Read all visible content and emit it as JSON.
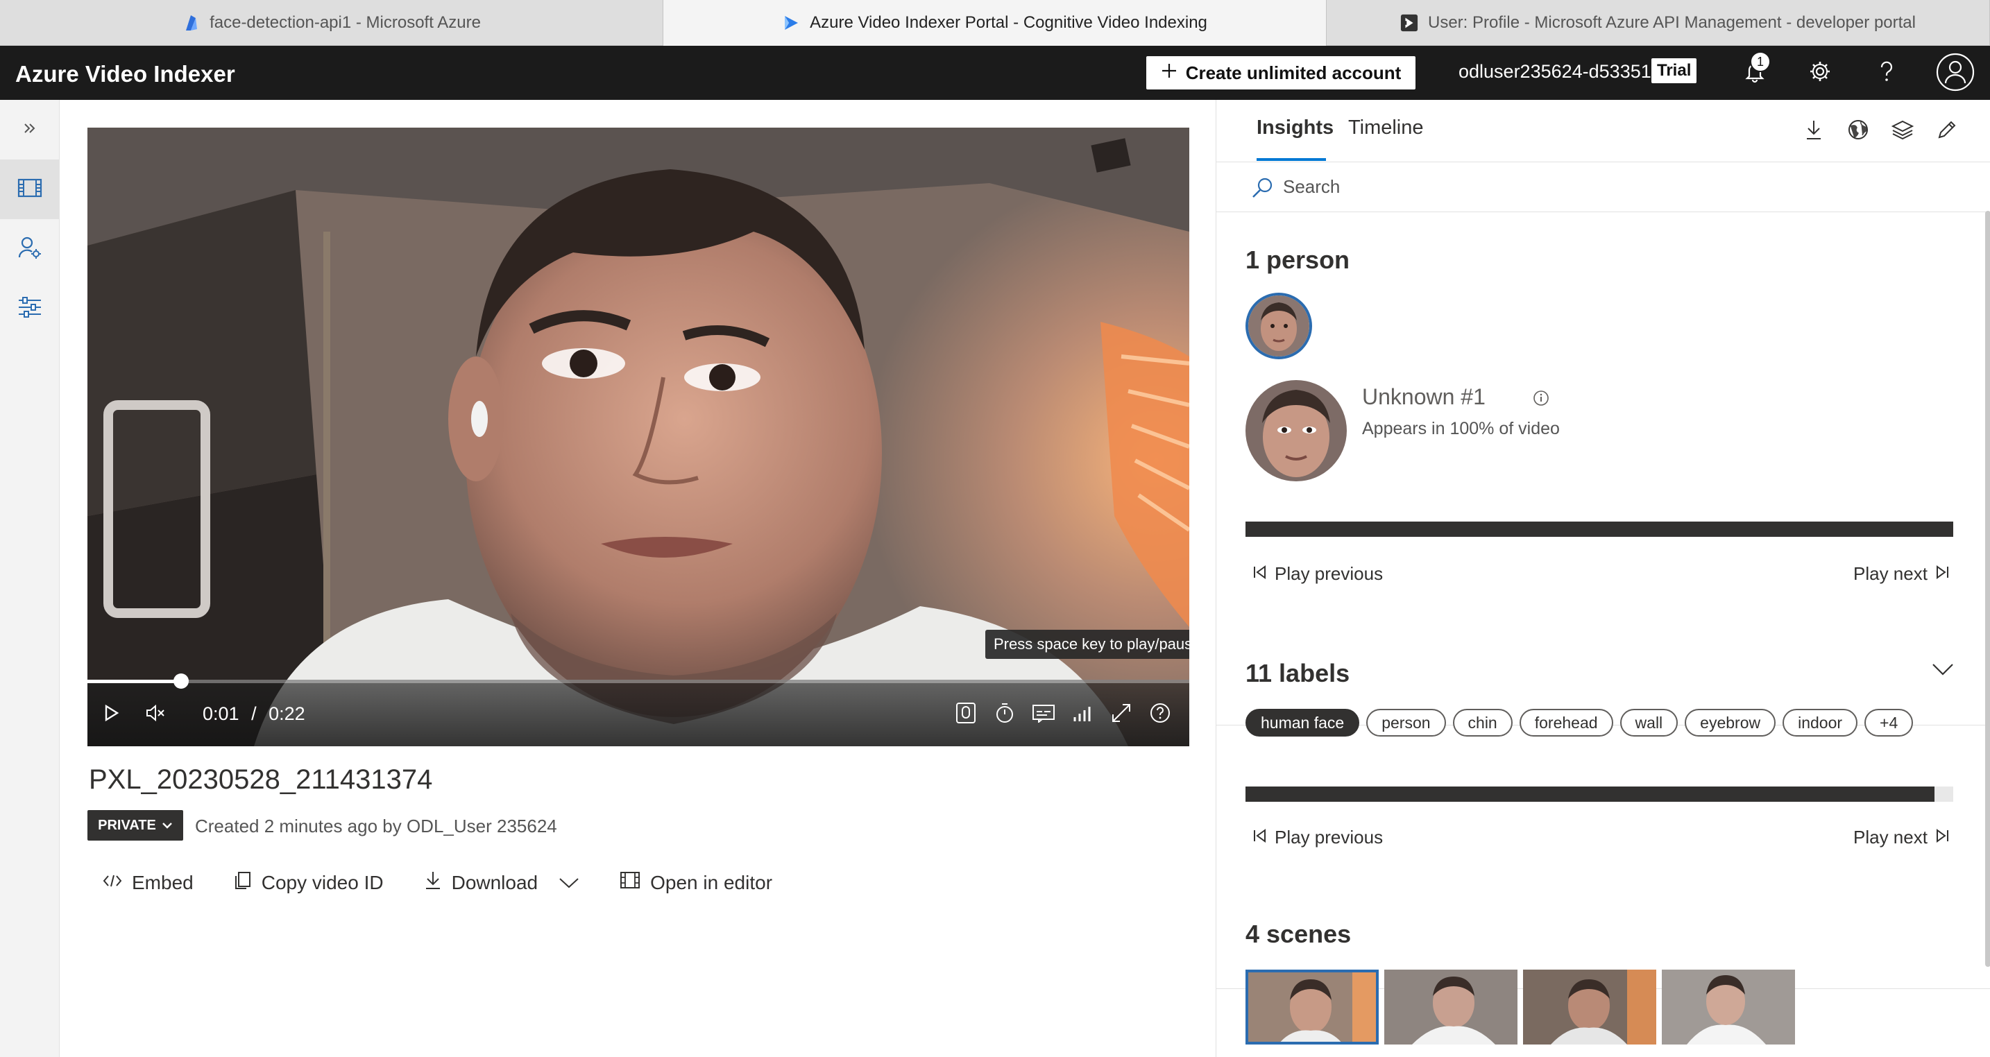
{
  "browser_tabs": [
    {
      "label": "face-detection-api1 - Microsoft Azure",
      "icon": "azure-function-icon"
    },
    {
      "label": "Azure Video Indexer Portal - Cognitive Video Indexing",
      "icon": "video-indexer-icon"
    },
    {
      "label": "User: Profile - Microsoft Azure API Management - developer portal",
      "icon": "api-management-icon"
    }
  ],
  "header": {
    "app_title": "Azure Video Indexer",
    "create_account_label": "Create unlimited account",
    "user_name": "odluser235624-d53351",
    "trial_badge": "Trial",
    "notification_count": "1"
  },
  "video": {
    "tooltip": "Press space key to play/pause the video",
    "current_time": "0:01",
    "separator": "/",
    "duration": "0:22",
    "progress_fraction": 0.085,
    "title": "PXL_20230528_211431374",
    "privacy": "PRIVATE",
    "created": "Created 2 minutes ago by ODL_User 235624"
  },
  "actions": {
    "embed": "Embed",
    "copy_id": "Copy video ID",
    "download": "Download",
    "open_editor": "Open in editor"
  },
  "insights": {
    "tabs": [
      "Insights",
      "Timeline"
    ],
    "search_placeholder": "Search",
    "people": {
      "title": "1 person",
      "name": "Unknown #1",
      "appears": "Appears in 100% of video",
      "bar_fraction": 1.0,
      "play_previous": "Play previous",
      "play_next": "Play next"
    },
    "labels": {
      "title": "11 labels",
      "items": [
        "human face",
        "person",
        "chin",
        "forehead",
        "wall",
        "eyebrow",
        "indoor",
        "+4"
      ],
      "selected": "human face",
      "bar_fraction": 0.974,
      "play_previous": "Play previous",
      "play_next": "Play next"
    },
    "scenes": {
      "title": "4 scenes"
    }
  },
  "colors": {
    "header_bg": "#1b1b1b",
    "accent": "#0078d4",
    "selection": "#2b6cb0"
  }
}
